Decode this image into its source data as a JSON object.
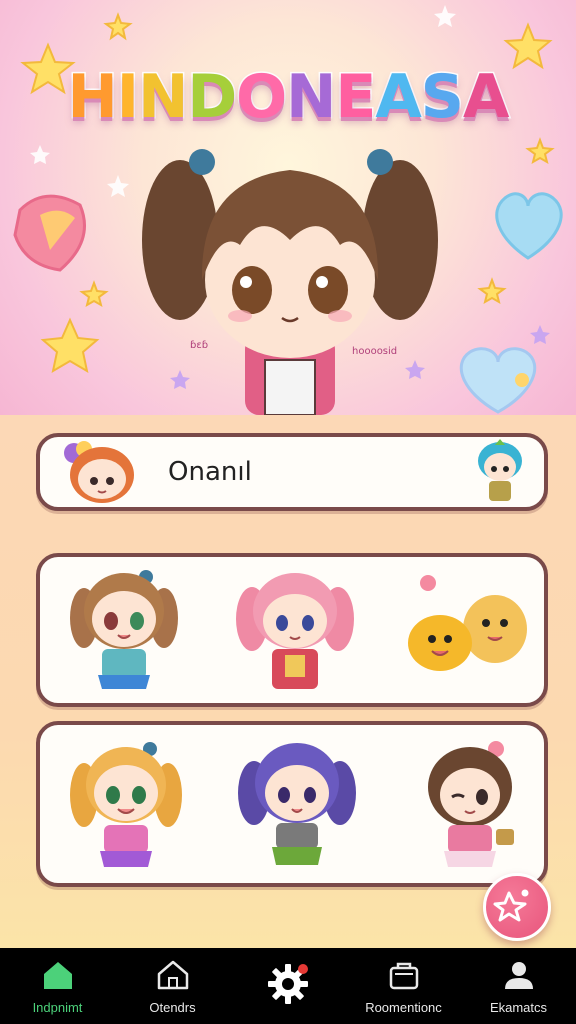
{
  "header": {
    "title": "HINDONEASA",
    "title_letters": [
      {
        "ch": "H",
        "color": "#ff9a2f"
      },
      {
        "ch": "I",
        "color": "#ffb52c"
      },
      {
        "ch": "N",
        "color": "#f2c230"
      },
      {
        "ch": "D",
        "color": "#a6cf3a"
      },
      {
        "ch": "O",
        "color": "#ff6aa8"
      },
      {
        "ch": "N",
        "color": "#a66ad6"
      },
      {
        "ch": "E",
        "color": "#ff5fa0"
      },
      {
        "ch": "A",
        "color": "#4fb8f0"
      },
      {
        "ch": "S",
        "color": "#58a8ef"
      },
      {
        "ch": "A",
        "color": "#e84f8f"
      }
    ],
    "sticker_left_text": "ɓɛɓ",
    "sticker_right_text": "hoooosid"
  },
  "search_card": {
    "text": "Onanıl"
  },
  "gallery": {
    "rows": [
      {
        "items": [
          "chibi-girl-blue-dress",
          "chibi-girl-pink-hair",
          "yellow-blob-pets"
        ]
      },
      {
        "items": [
          "chibi-girl-blonde",
          "chibi-girl-purple-hair",
          "chibi-girl-brown-hair"
        ]
      }
    ]
  },
  "fab": {
    "icon": "sparkle-star-icon"
  },
  "bottom_nav": {
    "items": [
      {
        "label": "Indpnimt",
        "icon": "home-icon",
        "active": true
      },
      {
        "label": "Otendrs",
        "icon": "house-outline-icon",
        "active": false
      },
      {
        "label": "",
        "icon": "gear-icon",
        "active": false
      },
      {
        "label": "Roomentionc",
        "icon": "bag-icon",
        "active": false
      },
      {
        "label": "Ekamatcs",
        "icon": "profile-icon",
        "active": false
      }
    ]
  },
  "colors": {
    "accent": "#4cd17a",
    "border": "#7a4a4a",
    "fab": "#e8557c",
    "notification_dot": "#e53935"
  }
}
